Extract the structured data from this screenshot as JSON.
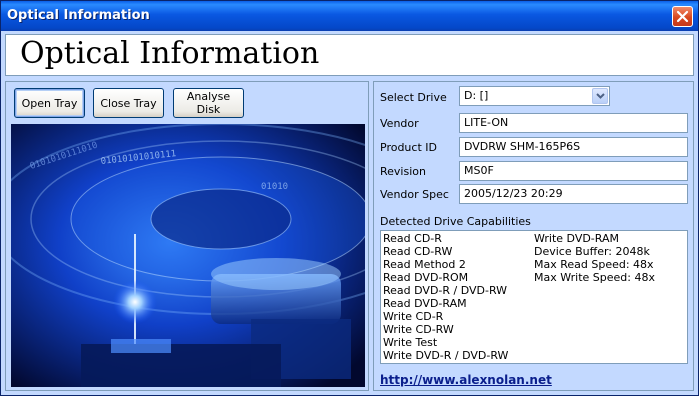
{
  "window": {
    "title": "Optical Information",
    "close_icon": "close-x-icon"
  },
  "header": {
    "title": "Optical Information"
  },
  "buttons": {
    "open_tray": "Open Tray",
    "close_tray": "Close Tray",
    "analyse_disk": "Analyse Disk"
  },
  "form": {
    "select_drive_label": "Select Drive",
    "select_drive_value": "D: []",
    "vendor_label": "Vendor",
    "vendor_value": "LITE-ON",
    "product_id_label": "Product ID",
    "product_id_value": "DVDRW SHM-165P6S",
    "revision_label": "Revision",
    "revision_value": "MS0F",
    "vendor_spec_label": "Vendor Spec",
    "vendor_spec_value": "2005/12/23 20:29"
  },
  "capabilities": {
    "label": "Detected Drive Capabilities",
    "column1": [
      "Read CD-R",
      "Read CD-RW",
      "Read Method 2",
      "Read DVD-ROM",
      "Read DVD-R / DVD-RW",
      "Read DVD-RAM",
      "Write CD-R",
      "Write CD-RW",
      "Write Test",
      "Write DVD-R / DVD-RW"
    ],
    "column2": [
      "Write DVD-RAM",
      "Device Buffer: 2048k",
      "Max Read Speed: 48x",
      "Max Write Speed: 48x"
    ]
  },
  "link": {
    "text": "http://www.alexnolan.net"
  },
  "colors": {
    "titlebar": "#0a58e2",
    "window_bg": "#c3d9ff",
    "link": "#0a1e8c"
  }
}
